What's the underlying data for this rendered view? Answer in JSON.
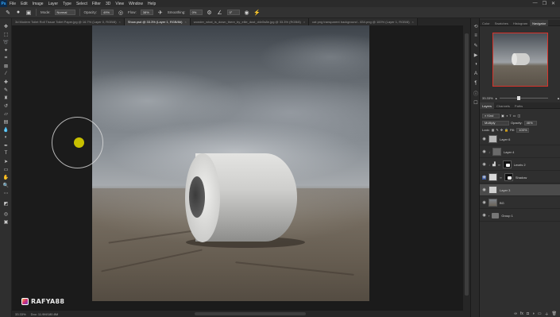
{
  "app": {
    "logo": "Ps",
    "menu": [
      "File",
      "Edit",
      "Image",
      "Layer",
      "Type",
      "Select",
      "Filter",
      "3D",
      "View",
      "Window",
      "Help"
    ],
    "window_controls": [
      "—",
      "❐",
      "✕"
    ]
  },
  "options_bar": {
    "mode_label": "Mode:",
    "mode_value": "Normal",
    "opacity_label": "Opacity:",
    "opacity_value": "49%",
    "flow_label": "Flow:",
    "flow_value": "38%",
    "smoothing_label": "Smoothing:",
    "smoothing_value": "0%",
    "angle_value": "0°",
    "brush_size": "5"
  },
  "tabs": [
    {
      "label": "3d Modern Toilet Roll Tissue Toilet Paper.jpg @ 16.7% (Layer 0, RGB/8)",
      "active": false
    },
    {
      "label": "Show.psd @ 33.3% (Layer 1, RGB/8#)",
      "active": true
    },
    {
      "label": "wonder_what_is_down_there_by_ellie_dust_d4n5s8e.jpg @ 33.3% (RGB/8)",
      "active": false
    },
    {
      "label": "cat png transparent background - 834.png @ 100% (Layer 1, RGB/8)",
      "active": false
    }
  ],
  "status": {
    "zoom": "33.33%",
    "doc": "Doc: 11.9M/180.8M"
  },
  "watermark": {
    "text": "RAFYA88"
  },
  "panels": {
    "top_tabs": [
      "Color",
      "Swatches",
      "Histogram",
      "Navigator"
    ],
    "active_top_tab": "Navigator",
    "navigator_zoom": "33.33%",
    "layer_tabs": [
      "Layers",
      "Channels",
      "Paths"
    ],
    "kind_label": "Kind",
    "blend_mode": "Multiply",
    "opacity_label": "Opacity:",
    "opacity_value": "46%",
    "lock_label": "Lock:",
    "fill_label": "Fill:",
    "fill_value": "100%",
    "layers": [
      {
        "name": "Layer 6",
        "type": "pixel",
        "selected": false
      },
      {
        "name": "Layer 4",
        "type": "pixel",
        "selected": false
      },
      {
        "name": "Levels 2",
        "type": "adjustment",
        "selected": false
      },
      {
        "name": "Shadow",
        "type": "mask",
        "selected": false
      },
      {
        "name": "Layer 3",
        "type": "pixel",
        "selected": true
      },
      {
        "name": "BG",
        "type": "pixel",
        "selected": false
      },
      {
        "name": "Group 1",
        "type": "group",
        "selected": false
      }
    ]
  },
  "colors": {
    "accent_highlight": "#3c5aa0",
    "brush_dot": "#c8c000",
    "navigator_frame": "#d9342b"
  }
}
